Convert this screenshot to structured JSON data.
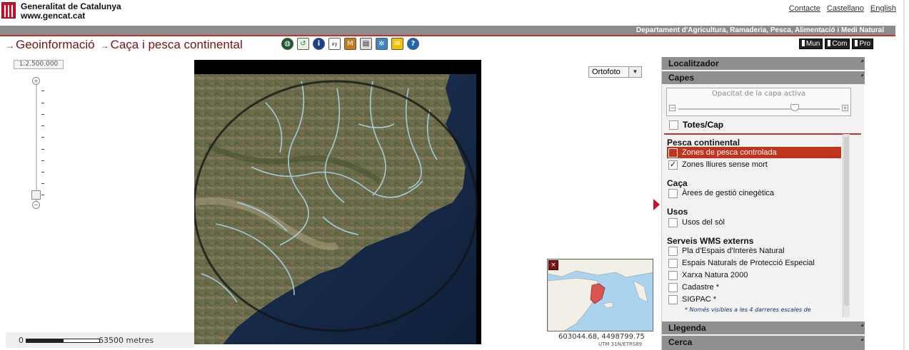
{
  "header": {
    "org_name": "Generalitat de Catalunya",
    "org_url": "www.gencat.cat",
    "links": [
      "Contacte",
      "Castellano",
      "English"
    ],
    "department": "Departament d'Agricultura, Ramaderia, Pesca, Alimentació i Medi Natural"
  },
  "breadcrumb": [
    "Geoinformació",
    "Caça i pesca continental"
  ],
  "toolbar": {
    "tools": [
      {
        "icon": "globe-icon",
        "color": "#1c5a2a"
      },
      {
        "icon": "refresh-icon",
        "color": "#2e8b3a"
      },
      {
        "icon": "info-icon",
        "color": "#1a3f8a"
      },
      {
        "icon": "coordinates-icon",
        "color": "#444444"
      },
      {
        "icon": "measure-icon",
        "color": "#b86c12"
      },
      {
        "icon": "print-icon",
        "color": "#555555"
      },
      {
        "icon": "settings-icon",
        "color": "#3d86c6"
      },
      {
        "icon": "mail-icon",
        "color": "#e0a800"
      },
      {
        "icon": "help-icon",
        "color": "#1a66b8"
      }
    ],
    "scope_buttons": [
      "Mun",
      "Com",
      "Pro"
    ]
  },
  "map": {
    "scale": "1:2.500.000",
    "basemap": "Ortofoto",
    "coordinates": "603044.68, 4498799.75",
    "projection": "UTM 31N/ETRS89",
    "scalebar_start": "0",
    "scalebar_end": "63500 metres",
    "zoom_level_fraction": 0.1
  },
  "panel": {
    "localitzador": "Localitzador",
    "capes": "Capes",
    "opacity_title": "Opacitat de la capa activa",
    "opacity_value": 0.72,
    "totes": "Totes/Cap",
    "groups": [
      {
        "title": "Pesca continental",
        "layers": [
          {
            "label": "Zones de pesca controlada",
            "checked": false,
            "selected": true
          },
          {
            "label": "Zones lliures sense mort",
            "checked": true,
            "selected": false
          }
        ]
      },
      {
        "title": "Caça",
        "layers": [
          {
            "label": "Àrees de gestió cinegètica",
            "checked": false,
            "selected": false
          }
        ]
      },
      {
        "title": "Usos",
        "layers": [
          {
            "label": "Usos del sòl",
            "checked": false,
            "selected": false
          }
        ]
      },
      {
        "title": "Serveis WMS externs",
        "layers": [
          {
            "label": "Pla d'Espais d'Interès Natural",
            "checked": false,
            "selected": false
          },
          {
            "label": "Espais Naturals de Protecció Especial",
            "checked": false,
            "selected": false
          },
          {
            "label": "Xarxa Natura 2000",
            "checked": false,
            "selected": false
          },
          {
            "label": "Cadastre *",
            "checked": false,
            "selected": false
          },
          {
            "label": "SIGPAC *",
            "checked": false,
            "selected": false
          }
        ]
      }
    ],
    "note": "* Només visibles a les 4 darreres escales de",
    "llegenda": "Llegenda",
    "cerca": "Cerca"
  },
  "colors": {
    "brand_red": "#c8102e",
    "selected_row": "#c2331d",
    "header_gray": "#8c8c8c"
  }
}
